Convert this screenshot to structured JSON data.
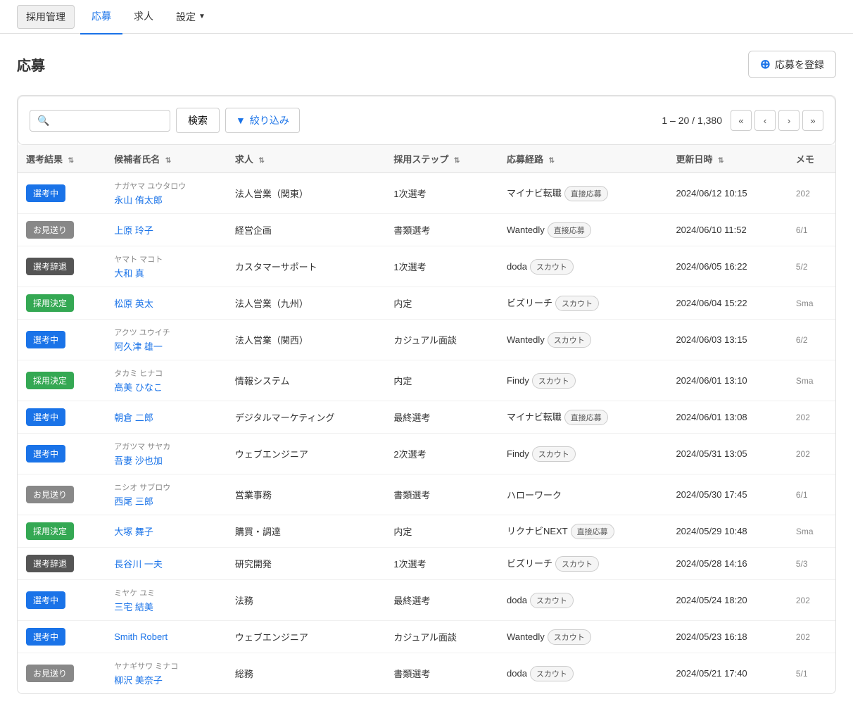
{
  "nav": {
    "items": [
      {
        "label": "採用管理",
        "key": "recruitment",
        "active": false,
        "isButton": true
      },
      {
        "label": "応募",
        "key": "applications",
        "active": true
      },
      {
        "label": "求人",
        "key": "jobs",
        "active": false
      },
      {
        "label": "設定",
        "key": "settings",
        "active": false,
        "hasDropdown": true
      }
    ]
  },
  "page": {
    "title": "応募",
    "register_button": "応募を登録"
  },
  "search": {
    "placeholder": "",
    "search_button": "検索",
    "filter_button": "絞り込み",
    "pagination_info": "1 – 20 / 1,380"
  },
  "table": {
    "columns": [
      {
        "key": "result",
        "label": "選考結果"
      },
      {
        "key": "name",
        "label": "候補者氏名"
      },
      {
        "key": "job",
        "label": "求人"
      },
      {
        "key": "step",
        "label": "採用ステップ"
      },
      {
        "key": "source",
        "label": "応募経路"
      },
      {
        "key": "updated",
        "label": "更新日時"
      },
      {
        "key": "memo",
        "label": "メモ"
      }
    ],
    "rows": [
      {
        "result": "選考中",
        "result_type": "blue",
        "kana": "ナガヤマ ユウタロウ",
        "name": "永山 侑太郎",
        "job": "法人営業（関東）",
        "step": "1次選考",
        "source": "マイナビ転職",
        "source_tag": "直接応募",
        "updated": "2024/06/12 10:15",
        "memo": "202"
      },
      {
        "result": "お見送り",
        "result_type": "gray",
        "kana": "",
        "name": "上原 玲子",
        "job": "経営企画",
        "step": "書類選考",
        "source": "Wantedly",
        "source_tag": "直接応募",
        "updated": "2024/06/10 11:52",
        "memo": "6/1"
      },
      {
        "result": "選考辞退",
        "result_type": "dark",
        "kana": "ヤマト マコト",
        "name": "大和 真",
        "job": "カスタマーサポート",
        "step": "1次選考",
        "source": "doda",
        "source_tag": "スカウト",
        "updated": "2024/06/05 16:22",
        "memo": "5/2"
      },
      {
        "result": "採用決定",
        "result_type": "green",
        "kana": "",
        "name": "松原 英太",
        "job": "法人営業（九州）",
        "step": "内定",
        "source": "ビズリーチ",
        "source_tag": "スカウト",
        "updated": "2024/06/04 15:22",
        "memo": "Sma"
      },
      {
        "result": "選考中",
        "result_type": "blue",
        "kana": "アクツ ユウイチ",
        "name": "阿久津 雄一",
        "job": "法人営業（関西）",
        "step": "カジュアル面談",
        "source": "Wantedly",
        "source_tag": "スカウト",
        "updated": "2024/06/03 13:15",
        "memo": "6/2"
      },
      {
        "result": "採用決定",
        "result_type": "green",
        "kana": "タカミ ヒナコ",
        "name": "高美 ひなこ",
        "job": "情報システム",
        "step": "内定",
        "source": "Findy",
        "source_tag": "スカウト",
        "updated": "2024/06/01 13:10",
        "memo": "Sma"
      },
      {
        "result": "選考中",
        "result_type": "blue",
        "kana": "",
        "name": "朝倉 二郎",
        "job": "デジタルマーケティング",
        "step": "最終選考",
        "source": "マイナビ転職",
        "source_tag": "直接応募",
        "updated": "2024/06/01 13:08",
        "memo": "202"
      },
      {
        "result": "選考中",
        "result_type": "blue",
        "kana": "アガツマ サヤカ",
        "name": "吾妻 沙也加",
        "job": "ウェブエンジニア",
        "step": "2次選考",
        "source": "Findy",
        "source_tag": "スカウト",
        "updated": "2024/05/31 13:05",
        "memo": "202"
      },
      {
        "result": "お見送り",
        "result_type": "gray",
        "kana": "ニシオ サブロウ",
        "name": "西尾 三郎",
        "job": "営業事務",
        "step": "書類選考",
        "source": "ハローワーク",
        "source_tag": "",
        "updated": "2024/05/30 17:45",
        "memo": "6/1"
      },
      {
        "result": "採用決定",
        "result_type": "green",
        "kana": "",
        "name": "大塚 舞子",
        "job": "購買・調達",
        "step": "内定",
        "source": "リクナビNEXT",
        "source_tag": "直接応募",
        "updated": "2024/05/29 10:48",
        "memo": "Sma"
      },
      {
        "result": "選考辞退",
        "result_type": "dark",
        "kana": "",
        "name": "長谷川 一夫",
        "job": "研究開発",
        "step": "1次選考",
        "source": "ビズリーチ",
        "source_tag": "スカウト",
        "updated": "2024/05/28 14:16",
        "memo": "5/3"
      },
      {
        "result": "選考中",
        "result_type": "blue",
        "kana": "ミヤケ ユミ",
        "name": "三宅 結美",
        "job": "法務",
        "step": "最終選考",
        "source": "doda",
        "source_tag": "スカウト",
        "updated": "2024/05/24 18:20",
        "memo": "202"
      },
      {
        "result": "選考中",
        "result_type": "blue",
        "kana": "Smith Robert",
        "name": "Smith Robert",
        "job": "ウェブエンジニア",
        "step": "カジュアル面談",
        "source": "Wantedly",
        "source_tag": "スカウト",
        "updated": "2024/05/23 16:18",
        "memo": "202"
      },
      {
        "result": "お見送り",
        "result_type": "gray",
        "kana": "ヤナギサワ ミナコ",
        "name": "柳沢 美奈子",
        "job": "総務",
        "step": "書類選考",
        "source": "doda",
        "source_tag": "スカウト",
        "updated": "2024/05/21 17:40",
        "memo": "5/1"
      }
    ]
  },
  "icons": {
    "search": "🔍",
    "filter": "▼",
    "plus": "⊕",
    "first_page": "«",
    "prev_page": "‹",
    "next_page": "›",
    "last_page": "»",
    "sort": "⇅",
    "dropdown": "▼"
  }
}
